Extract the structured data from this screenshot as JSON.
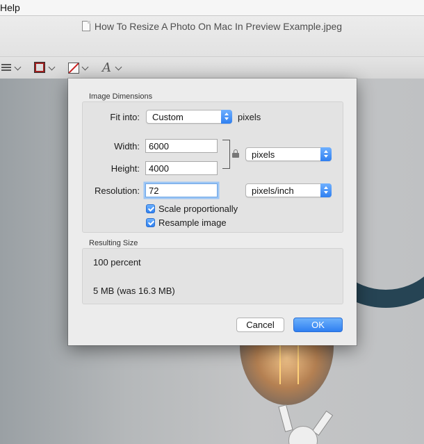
{
  "menubar": {
    "help": "Help"
  },
  "window": {
    "title": "How To Resize A Photo On Mac In Preview Example.jpeg"
  },
  "toolbar": {
    "tools": [
      {
        "icon": "shape-style-icon"
      },
      {
        "icon": "border-color-icon",
        "color": "#a02020"
      },
      {
        "icon": "fill-color-icon"
      },
      {
        "icon": "text-style-icon"
      }
    ]
  },
  "dialog": {
    "image_dimensions": {
      "section_label": "Image Dimensions",
      "fit_into_label": "Fit into:",
      "fit_into_value": "Custom",
      "fit_into_unit": "pixels",
      "width_label": "Width:",
      "width_value": "6000",
      "height_label": "Height:",
      "height_value": "4000",
      "size_unit": "pixels",
      "resolution_label": "Resolution:",
      "resolution_value": "72",
      "resolution_unit": "pixels/inch",
      "scale_proportionally": "Scale proportionally",
      "scale_proportionally_checked": true,
      "resample_image": "Resample image",
      "resample_image_checked": true
    },
    "resulting_size": {
      "section_label": "Resulting Size",
      "percent": "100 percent",
      "size": "5 MB (was 16.3 MB)"
    },
    "buttons": {
      "cancel": "Cancel",
      "ok": "OK"
    }
  },
  "colors": {
    "accent": "#2f7ff0",
    "focus_ring": "#9cc6f5"
  }
}
